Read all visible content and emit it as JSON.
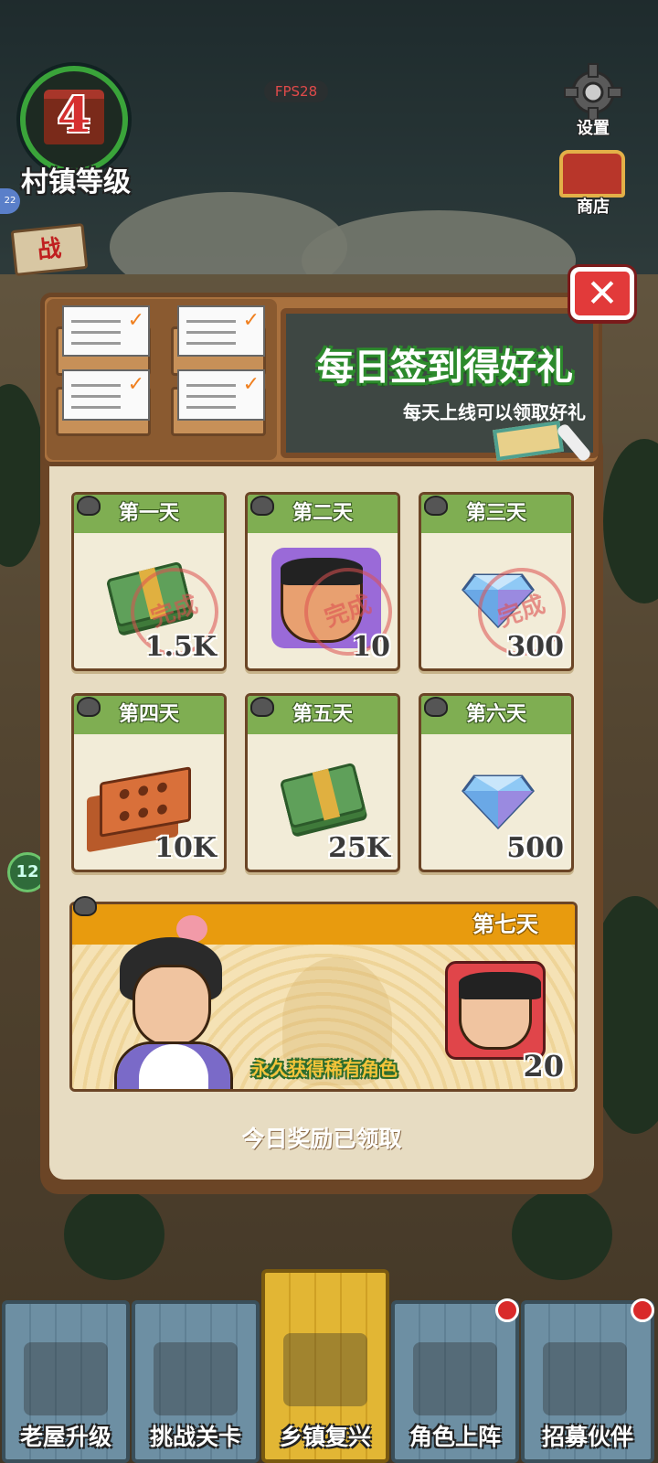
{
  "hud": {
    "fps": "FPS28",
    "village_level": "4",
    "village_label": "村镇等级",
    "settings_label": "设置",
    "shop_label": "商店",
    "left_tag": "战",
    "left_badge": "22",
    "side_badge": "12"
  },
  "dialog": {
    "title": "每日签到得好礼",
    "subtitle": "每天上线可以领取好礼",
    "close_glyph": "✕",
    "status": "今日奖励已领取",
    "days": [
      {
        "label": "第一天",
        "amount": "1.5K",
        "item": "cash-icon",
        "claimed": true,
        "stamp": "完成"
      },
      {
        "label": "第二天",
        "amount": "10",
        "item": "character-puzzle-icon",
        "claimed": true,
        "stamp": "完成"
      },
      {
        "label": "第三天",
        "amount": "300",
        "item": "diamond-icon",
        "claimed": true,
        "stamp": "完成"
      },
      {
        "label": "第四天",
        "amount": "10K",
        "item": "brick-icon",
        "claimed": false
      },
      {
        "label": "第五天",
        "amount": "25K",
        "item": "cash-icon",
        "claimed": false
      },
      {
        "label": "第六天",
        "amount": "500",
        "item": "diamond-icon",
        "claimed": false
      }
    ],
    "day7": {
      "label": "第七天",
      "tagline": "永久获得稀有角色",
      "amount": "20",
      "item": "character-puzzle-icon"
    }
  },
  "nav": {
    "items": [
      {
        "label": "老屋升级",
        "icon": "house-icon",
        "active": false,
        "notification": false
      },
      {
        "label": "挑战关卡",
        "icon": "chainsaw-icon",
        "active": false,
        "notification": false
      },
      {
        "label": "乡镇复兴",
        "icon": "market-stall-icon",
        "active": true,
        "notification": false
      },
      {
        "label": "角色上阵",
        "icon": "characters-icon",
        "active": false,
        "notification": true
      },
      {
        "label": "招募伙伴",
        "icon": "recruit-poster-icon",
        "active": false,
        "notification": true
      }
    ]
  },
  "colors": {
    "day_header": "#7fae52",
    "day7_header": "#e89b0e",
    "close": "#e23a3a",
    "title_outline": "#2c8a2c"
  }
}
